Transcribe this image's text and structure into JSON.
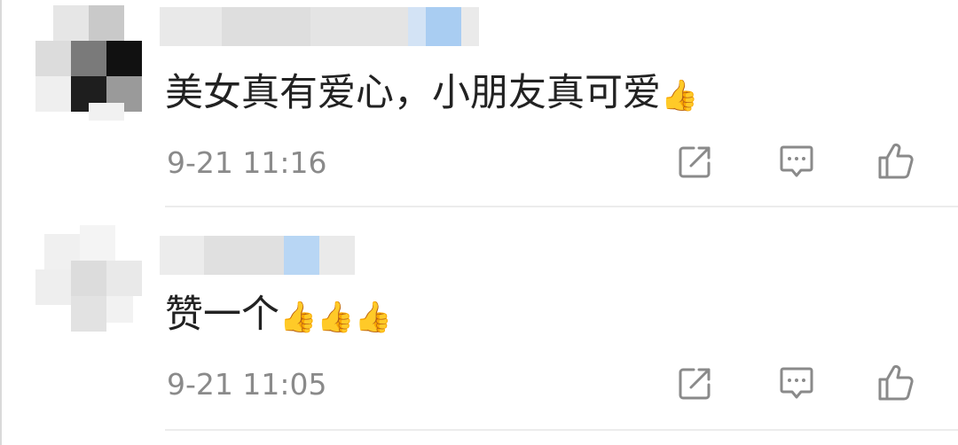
{
  "comments": [
    {
      "text": "美女真有爱心，小朋友真可爱",
      "emoji": "👍",
      "timestamp": "9-21 11:16",
      "actions": [
        "share-icon",
        "comment-icon",
        "thumbs-up-icon"
      ]
    },
    {
      "text": "赞一个",
      "emoji": "👍👍👍",
      "timestamp": "9-21 11:05",
      "actions": [
        "share-icon",
        "comment-icon",
        "thumbs-up-icon"
      ]
    }
  ],
  "colors": {
    "text": "#222222",
    "timestamp": "#8a8a8a",
    "icon": "#8a8a8a",
    "divider": "#ececec",
    "username_blur": "#e2e2e2",
    "username_blur_accent": "#a9cdf2"
  }
}
